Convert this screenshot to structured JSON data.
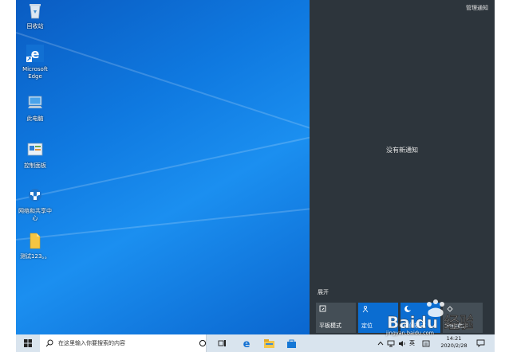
{
  "desktop": {
    "icons": [
      {
        "label": "回收站"
      },
      {
        "label": "Microsoft Edge"
      },
      {
        "label": "此电脑"
      },
      {
        "label": "控制面板"
      },
      {
        "label": "网络和共享中心"
      },
      {
        "label": "测试123。。"
      }
    ]
  },
  "action_center": {
    "manage_label": "管理通知",
    "empty_label": "没有新通知",
    "expand_label": "展开",
    "tiles": [
      {
        "label": "平板模式",
        "state": "off"
      },
      {
        "label": "定位",
        "state": "on"
      },
      {
        "label": "夜间模式",
        "state": "on"
      },
      {
        "label": "旋转锁定",
        "state": "off"
      }
    ]
  },
  "taskbar": {
    "search_placeholder": "在这里输入你要搜索的内容",
    "ime_label": "英",
    "time": "14:21",
    "date": "2020/2/28"
  },
  "watermark": {
    "brand": "Baidu 经验",
    "url": "jingyan.baidu.com"
  },
  "colors": {
    "accent": "#0b6dd1",
    "action_center_bg": "#2d353c",
    "taskbar_bg": "#d9e4ee"
  }
}
